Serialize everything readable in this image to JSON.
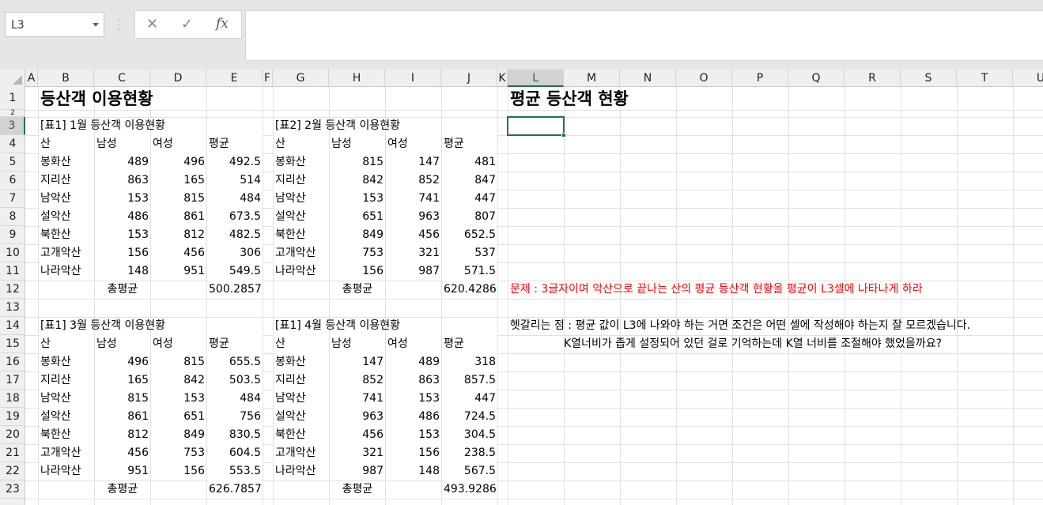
{
  "formula_bar": {
    "name_box": "L3",
    "cancel_icon": "✕",
    "enter_icon": "✓",
    "fx_label": "fx",
    "formula": ""
  },
  "columns": [
    "A",
    "B",
    "C",
    "D",
    "E",
    "F",
    "G",
    "H",
    "I",
    "J",
    "K",
    "L",
    "M",
    "N",
    "O",
    "P",
    "Q",
    "R",
    "S",
    "T",
    "U"
  ],
  "rows": [
    "1",
    "2",
    "3",
    "4",
    "5",
    "6",
    "7",
    "8",
    "9",
    "10",
    "11",
    "12",
    "13",
    "14",
    "15",
    "16",
    "17",
    "18",
    "19",
    "20",
    "21",
    "22",
    "23"
  ],
  "selected_cell": "L3",
  "sheet": {
    "title_left": "등산객 이용현황",
    "title_right": "평균 등산객 현황",
    "headers": [
      "산",
      "남성",
      "여성",
      "평균"
    ],
    "tables": [
      {
        "caption": "[표1] 1월 등산객 이용현황",
        "rows": [
          [
            "봉화산",
            "489",
            "496",
            "492.5"
          ],
          [
            "지리산",
            "863",
            "165",
            "514"
          ],
          [
            "남악산",
            "153",
            "815",
            "484"
          ],
          [
            "설악산",
            "486",
            "861",
            "673.5"
          ],
          [
            "북한산",
            "153",
            "812",
            "482.5"
          ],
          [
            "고개악산",
            "156",
            "456",
            "306"
          ],
          [
            "나라악산",
            "148",
            "951",
            "549.5"
          ]
        ],
        "total_label": "총평균",
        "total": "500.2857"
      },
      {
        "caption": "[표2] 2월 등산객 이용현황",
        "rows": [
          [
            "봉화산",
            "815",
            "147",
            "481"
          ],
          [
            "지리산",
            "842",
            "852",
            "847"
          ],
          [
            "남악산",
            "153",
            "741",
            "447"
          ],
          [
            "설악산",
            "651",
            "963",
            "807"
          ],
          [
            "북한산",
            "849",
            "456",
            "652.5"
          ],
          [
            "고개악산",
            "753",
            "321",
            "537"
          ],
          [
            "나라악산",
            "156",
            "987",
            "571.5"
          ]
        ],
        "total_label": "총평균",
        "total": "620.4286"
      },
      {
        "caption": "[표1] 3월 등산객 이용현황",
        "rows": [
          [
            "봉화산",
            "496",
            "815",
            "655.5"
          ],
          [
            "지리산",
            "165",
            "842",
            "503.5"
          ],
          [
            "남악산",
            "815",
            "153",
            "484"
          ],
          [
            "설악산",
            "861",
            "651",
            "756"
          ],
          [
            "북한산",
            "812",
            "849",
            "830.5"
          ],
          [
            "고개악산",
            "456",
            "753",
            "604.5"
          ],
          [
            "나라악산",
            "951",
            "156",
            "553.5"
          ]
        ],
        "total_label": "총평균",
        "total": "626.7857"
      },
      {
        "caption": "[표1] 4월 등산객 이용현황",
        "rows": [
          [
            "봉화산",
            "147",
            "489",
            "318"
          ],
          [
            "지리산",
            "852",
            "863",
            "857.5"
          ],
          [
            "남악산",
            "741",
            "153",
            "447"
          ],
          [
            "설악산",
            "963",
            "486",
            "724.5"
          ],
          [
            "북한산",
            "456",
            "153",
            "304.5"
          ],
          [
            "고개악산",
            "321",
            "156",
            "238.5"
          ],
          [
            "나라악산",
            "987",
            "148",
            "567.5"
          ]
        ],
        "total_label": "총평균",
        "total": "493.9286"
      }
    ],
    "problem_text": "문제 : 3글자이며 악산으로 끝나는 산의 평균 등산객 현황을 평균이 L3셀에 나타나게 하라",
    "note_line1": "헷갈리는 점 : 평균 값이 L3에 나와야 하는 거면 조건은 어떤 셀에 작성해야 하는지 잘 모르겠습니다.",
    "note_line2": "K열너비가 좁게 설정되어 있던 걸로 기억하는데 K열 너비를 조절해야 했었을까요?",
    "problem_color": "#ff0000",
    "accent_color": "#217346"
  }
}
